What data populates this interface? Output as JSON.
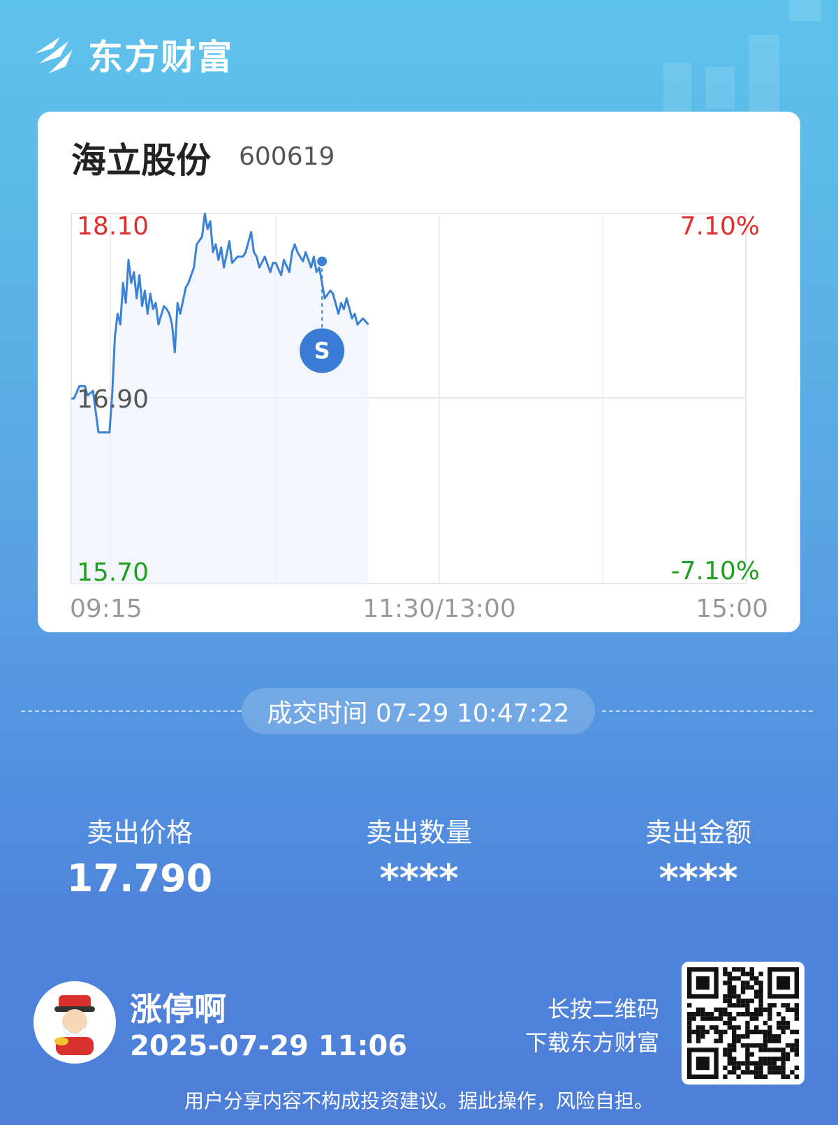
{
  "brand": {
    "name": "东方财富"
  },
  "stock": {
    "name": "海立股份",
    "code": "600619"
  },
  "chart_data": {
    "type": "line",
    "title": "",
    "xlabel": "",
    "ylabel": "",
    "y_left_labels": {
      "top": "18.10",
      "mid": "16.90",
      "bottom": "15.70"
    },
    "y_right_labels": {
      "top": "7.10%",
      "bottom": "-7.10%"
    },
    "x_tick_labels": [
      "09:15",
      "11:30/13:00",
      "15:00"
    ],
    "ylim": [
      15.7,
      18.1
    ],
    "reference_price": 16.9,
    "colors": {
      "line": "#3b82d4",
      "up": "#e02e2e",
      "down": "#1fa11f",
      "mid": "#555555",
      "grid": "#e6e6e6"
    },
    "series": [
      {
        "x": [
          "09:15",
          "09:16",
          "09:18",
          "09:20",
          "09:21",
          "09:23",
          "09:25",
          "09:27",
          "09:29",
          "09:30",
          "09:31",
          "09:32",
          "09:33",
          "09:34",
          "09:35",
          "09:36",
          "09:37",
          "09:38",
          "09:39",
          "09:40",
          "09:41",
          "09:42",
          "09:43",
          "09:44",
          "09:45",
          "09:46",
          "09:47",
          "09:49",
          "09:50",
          "09:51",
          "09:52",
          "09:53",
          "09:54",
          "09:55",
          "09:57",
          "09:58",
          "10:00",
          "10:01",
          "10:03",
          "10:04",
          "10:05",
          "10:06",
          "10:07",
          "10:08",
          "10:09",
          "10:10",
          "10:11",
          "10:13",
          "10:14",
          "10:16",
          "10:18",
          "10:19",
          "10:21",
          "10:22",
          "10:23",
          "10:24",
          "10:26",
          "10:28",
          "10:29",
          "10:30",
          "10:32",
          "10:33",
          "10:35",
          "10:36",
          "10:37",
          "10:38",
          "10:40",
          "10:41",
          "10:43",
          "10:44",
          "10:45",
          "10:46",
          "10:47",
          "10:48",
          "10:50",
          "10:51",
          "10:53",
          "10:54",
          "10:55",
          "10:56",
          "10:58",
          "10:59",
          "11:00",
          "11:02",
          "11:03",
          "11:04"
        ],
        "values": [
          16.9,
          16.9,
          16.98,
          16.98,
          16.92,
          16.95,
          16.68,
          16.68,
          16.68,
          16.92,
          17.3,
          17.45,
          17.38,
          17.65,
          17.52,
          17.8,
          17.65,
          17.72,
          17.55,
          17.7,
          17.5,
          17.6,
          17.45,
          17.58,
          17.48,
          17.52,
          17.38,
          17.5,
          17.48,
          17.45,
          17.38,
          17.2,
          17.52,
          17.45,
          17.62,
          17.65,
          17.75,
          17.9,
          17.95,
          18.1,
          18.0,
          18.05,
          17.85,
          17.9,
          17.8,
          17.88,
          17.75,
          17.92,
          17.78,
          17.82,
          17.82,
          17.85,
          17.98,
          17.85,
          17.82,
          17.75,
          17.82,
          17.72,
          17.78,
          17.78,
          17.7,
          17.8,
          17.72,
          17.85,
          17.9,
          17.85,
          17.79,
          17.85,
          17.75,
          17.82,
          17.72,
          17.75,
          17.65,
          17.55,
          17.6,
          17.58,
          17.45,
          17.52,
          17.48,
          17.55,
          17.42,
          17.45,
          17.38,
          17.42,
          17.4,
          17.38
        ]
      }
    ],
    "marker": {
      "label": "S",
      "time": "10:47",
      "price": 17.79
    }
  },
  "trade": {
    "time_label": "成交时间 07-29 10:47:22"
  },
  "stats": [
    {
      "label": "卖出价格",
      "value": "17.790"
    },
    {
      "label": "卖出数量",
      "value": "****"
    },
    {
      "label": "卖出金额",
      "value": "****"
    }
  ],
  "user": {
    "name": "涨停啊",
    "time": "2025-07-29 11:06"
  },
  "qr": {
    "hint_line1": "长按二维码",
    "hint_line2": "下载东方财富"
  },
  "disclaimer": "用户分享内容不构成投资建议。据此操作，风险自担。"
}
